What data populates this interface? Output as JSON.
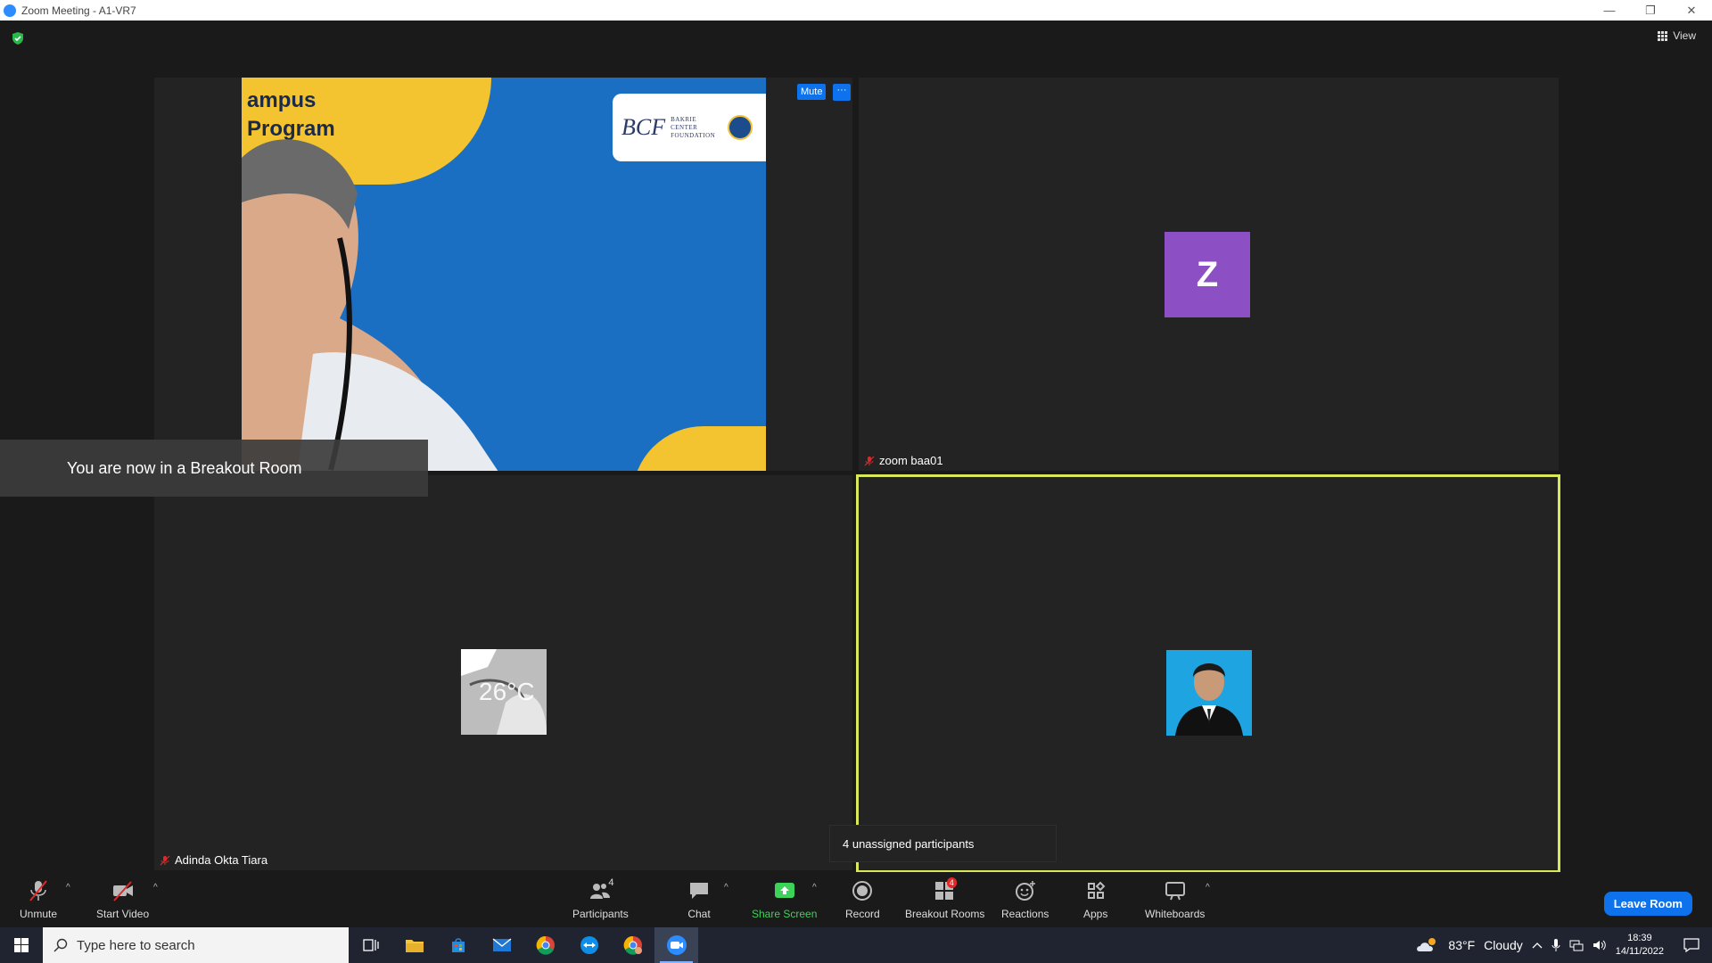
{
  "window": {
    "title": "Zoom Meeting - A1-VR7",
    "minimize": "—",
    "restore": "❐",
    "close": "✕"
  },
  "header": {
    "view_label": "View"
  },
  "tiles": {
    "shared": {
      "slide_text_line1": "ampus",
      "slide_text_line2": "Program",
      "logo_letters": "BCF",
      "logo_org_line1": "BAKRIE",
      "logo_org_line2": "CENTER",
      "logo_org_line3": "FOUNDATION",
      "mute_label": "Mute",
      "more_label": "···"
    },
    "zoom_baa": {
      "avatar_letter": "Z",
      "name": "zoom baa01"
    },
    "adinda": {
      "avatar_text": "26°C",
      "name": "Adinda Okta Tiara"
    },
    "active_speaker": {
      "highlight_color": "#d9e85a"
    }
  },
  "toast": {
    "message": "You are now in a Breakout Room"
  },
  "tooltip": {
    "text": "4 unassigned participants"
  },
  "toolbar": {
    "unmute": "Unmute",
    "start_video": "Start Video",
    "participants": "Participants",
    "participants_count": "4",
    "chat": "Chat",
    "share_screen": "Share Screen",
    "record": "Record",
    "breakout_rooms": "Breakout Rooms",
    "breakout_badge": "4",
    "reactions": "Reactions",
    "apps": "Apps",
    "whiteboards": "Whiteboards",
    "leave_room": "Leave Room",
    "caret": "^"
  },
  "taskbar": {
    "search_placeholder": "Type here to search",
    "weather_temp": "83°F",
    "weather_desc": "Cloudy",
    "time": "18:39",
    "date": "14/11/2022"
  },
  "colors": {
    "accent": "#0e72ed",
    "share_green": "#3dd25a",
    "badge_red": "#e02828",
    "avatar_purple": "#8c4fc4"
  }
}
